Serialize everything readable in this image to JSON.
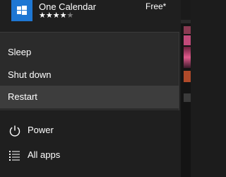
{
  "app": {
    "name": "One Calendar",
    "price": "Free*",
    "rating": {
      "filled": 4,
      "total": 5
    }
  },
  "power_menu": {
    "items": [
      {
        "label": "Sleep"
      },
      {
        "label": "Shut down"
      },
      {
        "label": "Restart",
        "highlighted": true
      }
    ]
  },
  "start": {
    "power_label": "Power",
    "all_apps_label": "All apps"
  },
  "colors": {
    "app_icon_bg": "#1e77d3",
    "menu_bg": "#2b2b2b",
    "highlight_bg": "#3d3d3d"
  },
  "icons": {
    "app": "windows-logo-icon",
    "power": "power-icon",
    "all_apps": "list-icon"
  }
}
